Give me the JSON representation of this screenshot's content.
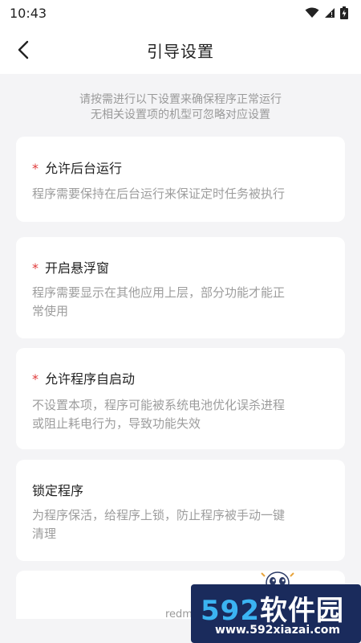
{
  "status": {
    "time": "10:43",
    "icons": [
      "wifi-icon",
      "signal-icon",
      "battery-icon"
    ]
  },
  "header": {
    "title": "引导设置",
    "back_icon": "back-arrow-icon"
  },
  "intro": {
    "line1": "请按需进行以下设置来确保程序正常运行",
    "line2": "无相关设置项的机型可忽略对应设置"
  },
  "cards": [
    {
      "required_mark": "*",
      "title": "允许后台运行",
      "desc_line1": "程序需要保持在后台运行来保证定时任务被执行",
      "desc_line2": ""
    },
    {
      "required_mark": "*",
      "title": "开启悬浮窗",
      "desc_line1": "程序需要显示在其他应用上层，部分功能才能正",
      "desc_line2": "常使用"
    },
    {
      "required_mark": "*",
      "title": "允许程序自启动",
      "desc_line1": "不设置本项，程序可能被系统电池优化误杀进程",
      "desc_line2": "或阻止耗电行为，导致功能失效"
    },
    {
      "required_mark": "",
      "title": "锁定程序",
      "desc_line1": "为程序保活，给程序上锁，防止程序被手动一键",
      "desc_line2": "清理"
    }
  ],
  "footer": {
    "text": "redmi"
  },
  "watermark": {
    "big_num": "592",
    "big_cn": "软件园",
    "url": "www.592xiazai.com"
  },
  "colors": {
    "background": "#f4f4f6",
    "card": "#ffffff",
    "required": "#e03b3b",
    "desc": "#9d9d9d",
    "watermark_bg": "#1a2b5c",
    "watermark_accent": "#3bb4f2"
  }
}
